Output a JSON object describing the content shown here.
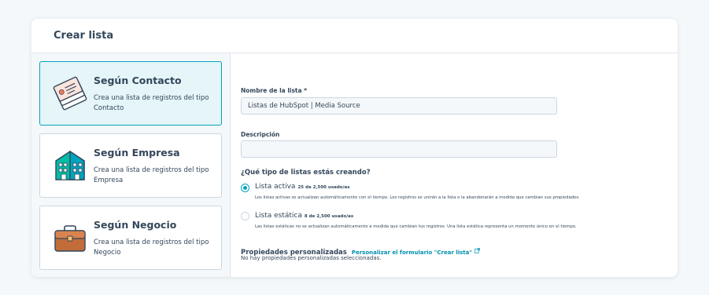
{
  "header": {
    "title": "Crear lista"
  },
  "options": [
    {
      "title": "Según Contacto",
      "desc": "Crea una lista de registros del tipo Contacto",
      "selected": true,
      "icon": "contact-cards-icon"
    },
    {
      "title": "Según Empresa",
      "desc": "Crea una lista de registros del tipo Empresa",
      "selected": false,
      "icon": "company-building-icon"
    },
    {
      "title": "Según Negocio",
      "desc": "Crea una lista de registros del tipo Negocio",
      "selected": false,
      "icon": "briefcase-icon"
    }
  ],
  "form": {
    "name_label": "Nombre de la lista *",
    "name_value": "Listas de HubSpot | Media Source",
    "desc_label": "Descripción",
    "desc_value": "",
    "question": "¿Qué tipo de listas estás creando?",
    "active": {
      "label": "Lista activa",
      "count": "25 de 2,500 usado/as",
      "help": "Los listas activas se actualizan automáticamente con el tiempo. Los registros se unirán a la lista o la abandonarán a medida que cambian sus propiedades.",
      "checked": true
    },
    "static": {
      "label": "Lista estática",
      "count": "8 de 2,500 usado/as",
      "help": "Las listas estáticas no se actualizan automáticamente a medida que cambian tus registros. Una lista estática representa un momento único en el tiempo.",
      "checked": false
    },
    "props_title": "Propiedades personalizadas",
    "props_link": "Personalizar el formulario \"Crear lista\"",
    "props_none": "No hay propiedades personalizadas seleccionadas."
  },
  "colors": {
    "accent": "#00a4bd",
    "link": "#0091ae",
    "text": "#33475b",
    "border": "#cbd6e2",
    "selected_bg": "#e5f5f8"
  }
}
